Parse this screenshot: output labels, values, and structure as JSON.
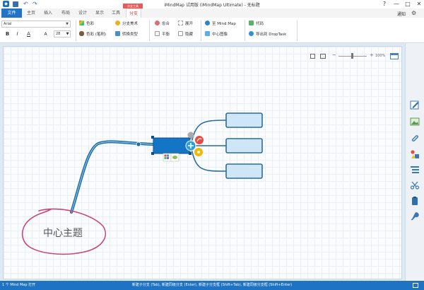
{
  "titlebar": {
    "title": "iMindMap 试用版 (iMindMap Ultimate) - 无标题",
    "help": "?",
    "minimize": "—",
    "maximize": "□",
    "close": "✕"
  },
  "tabs": {
    "file": "文件",
    "home": "主页",
    "insert": "插入",
    "layout": "布局",
    "design": "设计",
    "view": "显示",
    "tools": "工具",
    "branch": "分支",
    "context_label": "分支工具",
    "notify": "通知"
  },
  "ribbon": {
    "font_name": "Arial",
    "bold": "B",
    "italic": "I",
    "font_color": "A",
    "font_size_icon": "A",
    "font_size": "28",
    "color": "色彩",
    "color_brush": "色彩 (笔刷)",
    "branch_style": "分支美术",
    "transform_type": "转换类型",
    "heal": "愈合",
    "balance": "平衡",
    "expand": "展开",
    "collapse": "隐藏",
    "to_mindmap": "至 Mind Map",
    "central_image": "中心图像",
    "code": "代码",
    "export_droptask": "导出到 DropTask"
  },
  "canvas": {
    "zoom_minus": "−",
    "zoom_plus": "+",
    "zoom": "100%",
    "central_topic": "中心主题"
  },
  "colors": {
    "accent": "#1e73c4",
    "branch": "#1c6aa0",
    "node_fill": "#cfe6f7",
    "node_border": "#2a6c9a",
    "annotation": "#c9467f"
  },
  "statusbar": {
    "left": "1 个 Mind Map 打开",
    "hint": "新建子分支 (Tab), 新建同级分支 (Enter), 新建子分支框 (Shift+Tab), 新建同级分支框 (Shift+Enter)"
  }
}
